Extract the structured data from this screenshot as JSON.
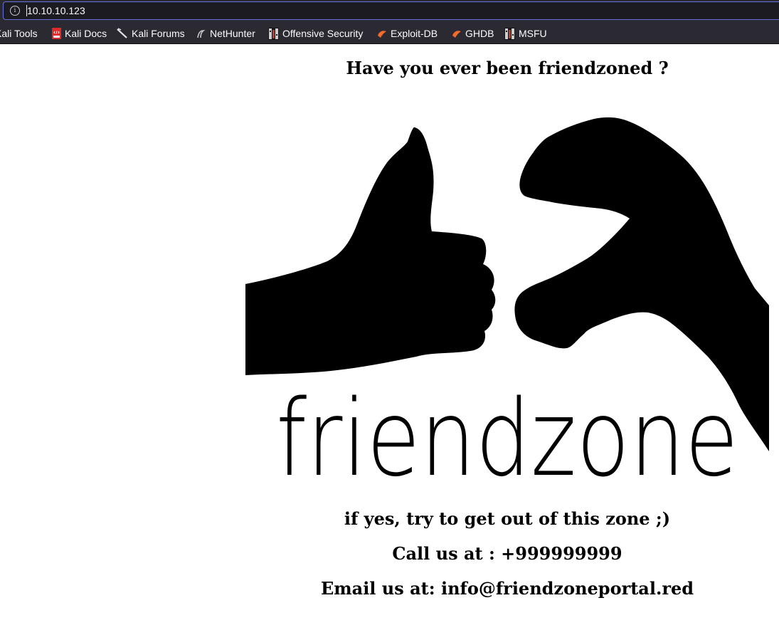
{
  "browser": {
    "url": "10.10.10.123",
    "bookmarks": [
      {
        "label": "Kali Tools",
        "icon": "kali-icon"
      },
      {
        "label": "Kali Docs",
        "icon": "kali-docs-icon"
      },
      {
        "label": "Kali Forums",
        "icon": "kali-forums-icon"
      },
      {
        "label": "NetHunter",
        "icon": "nethunter-icon"
      },
      {
        "label": "Offensive Security",
        "icon": "offsec-icon"
      },
      {
        "label": "Exploit-DB",
        "icon": "exploit-db-icon"
      },
      {
        "label": "GHDB",
        "icon": "ghdb-icon"
      },
      {
        "label": "MSFU",
        "icon": "offsec-icon"
      }
    ]
  },
  "page": {
    "heading": "Have you ever been friendzoned ?",
    "image_text": "friendzone",
    "line_zone": "if yes, try to get out of this zone ;)",
    "line_call": "Call us at : +999999999",
    "line_email": "Email us at: info@friendzoneportal.red"
  },
  "colors": {
    "chrome_bg": "#2b2a33",
    "urlbar_bg": "#1c1b22",
    "urlbar_focus": "#6672d9",
    "page_bg": "#ffffff",
    "text": "#000000"
  }
}
